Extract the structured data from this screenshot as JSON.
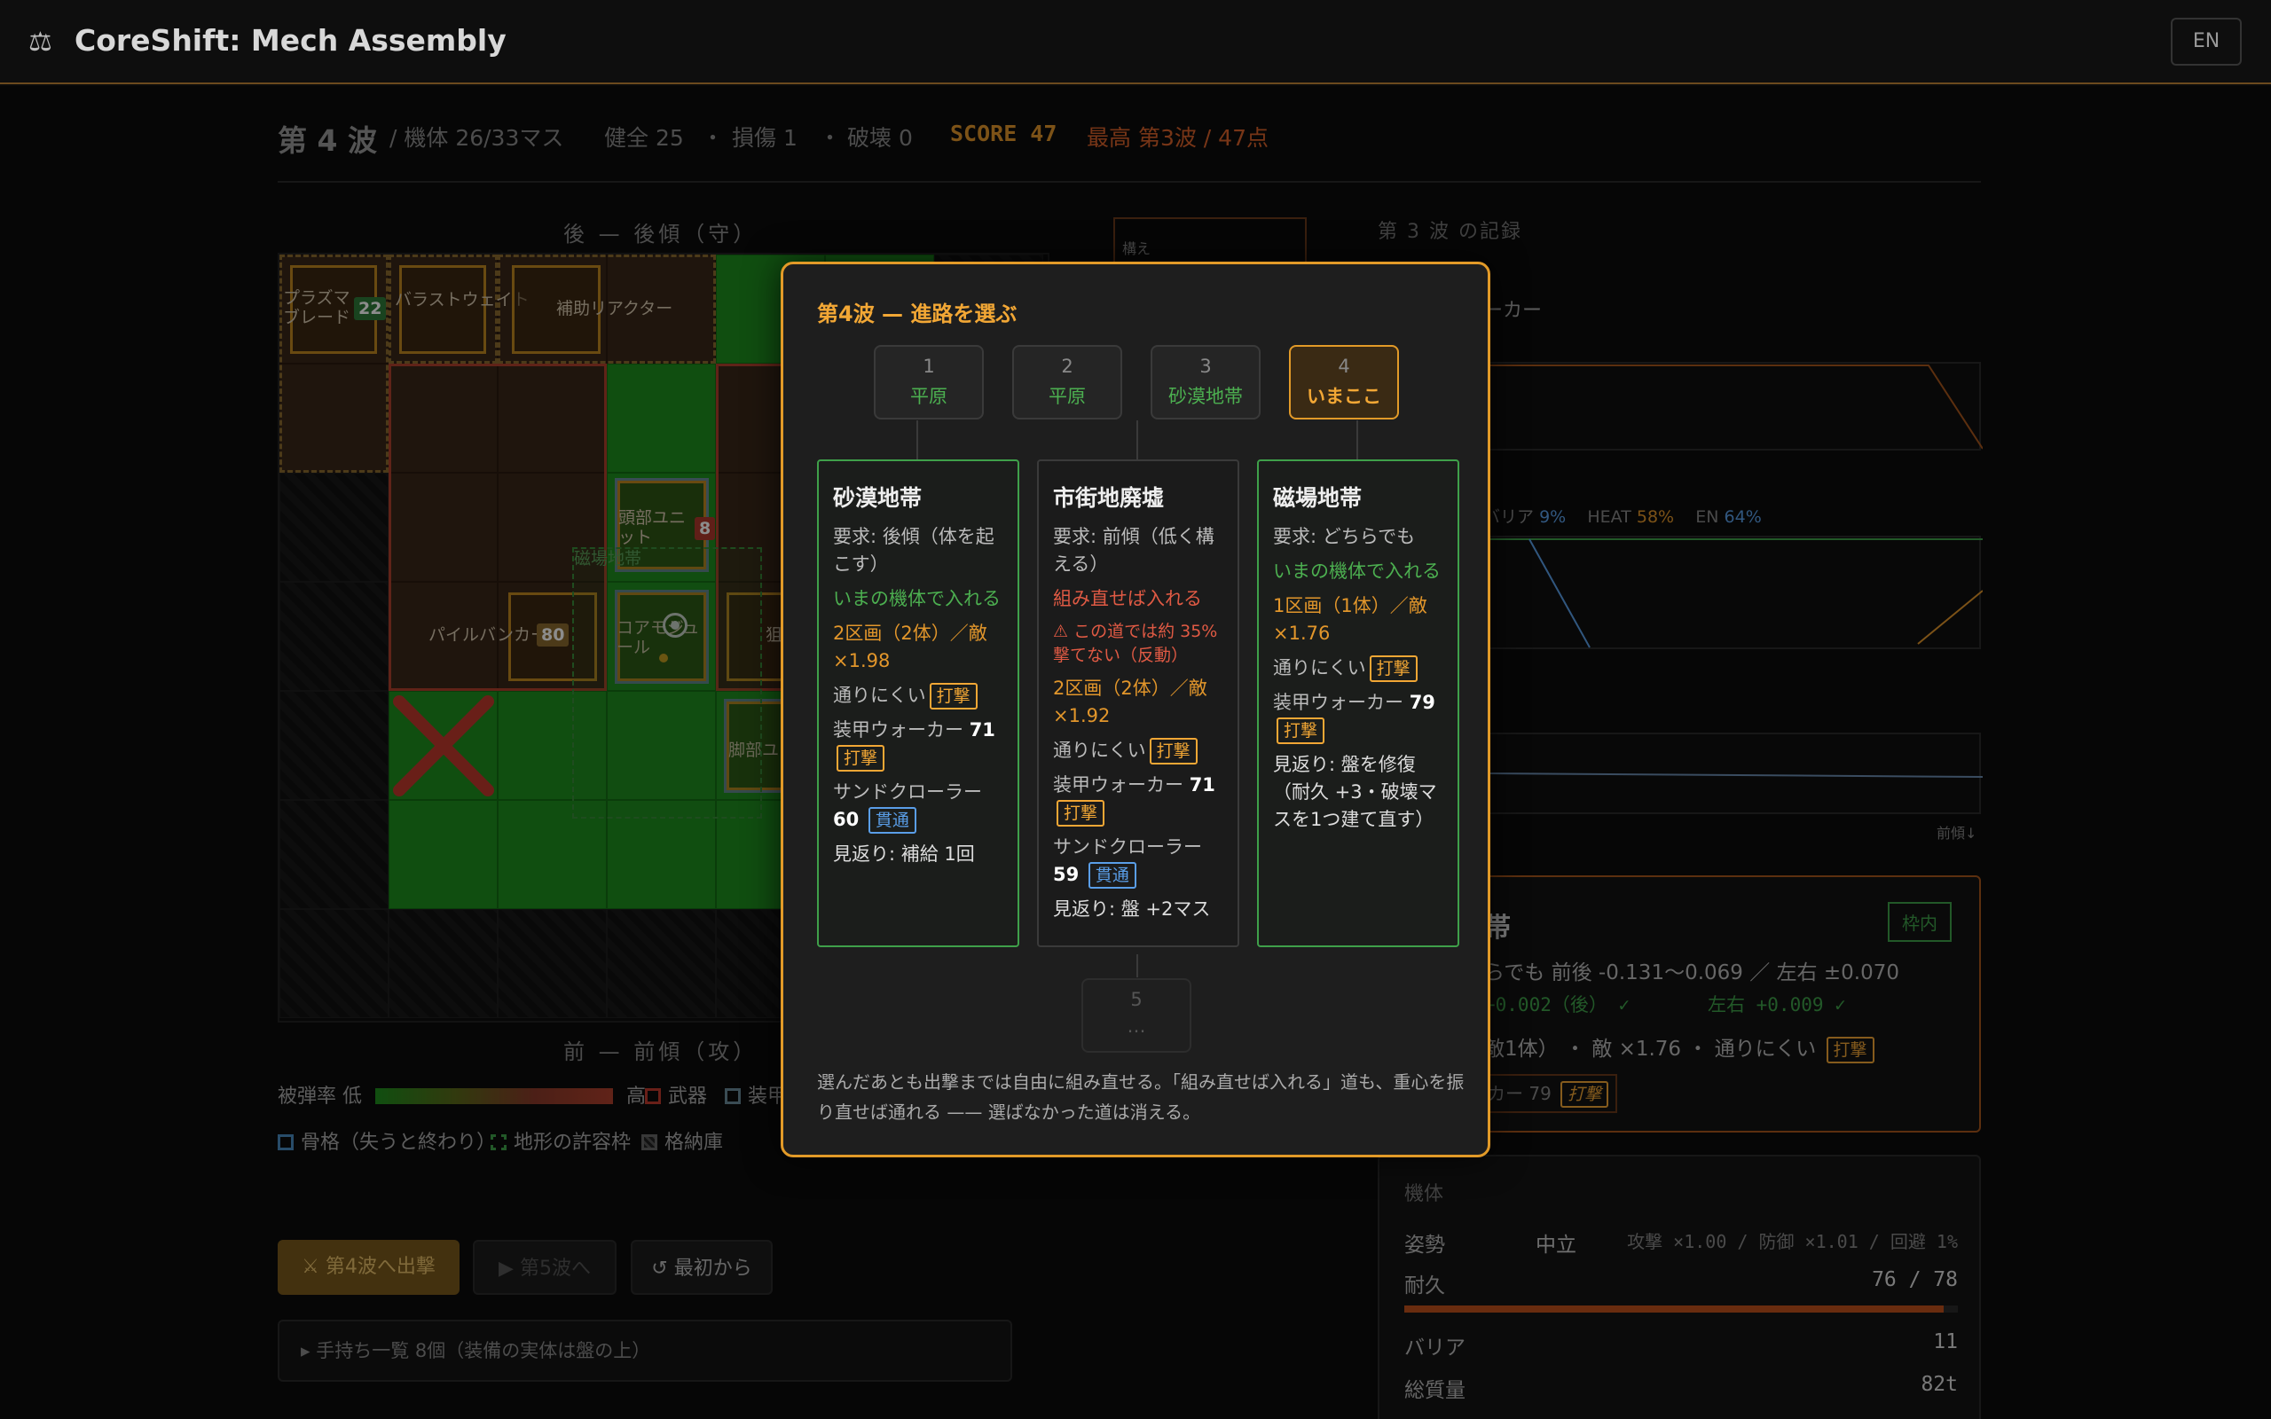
{
  "header": {
    "title": "CoreShift: Mech Assembly",
    "logo_icon": "balance-icon",
    "lang_button": "EN"
  },
  "status": {
    "wave": "第 4 波",
    "frame": "/ 機体 26/33マス",
    "healthy": "健全 25",
    "sep1": "・",
    "damaged": "損傷 1",
    "sep2": "・",
    "destroyed": "破壊 0",
    "score": "SCORE 47",
    "best": "最高 第3波 / 47点"
  },
  "grid": {
    "top_label": "後 — 後傾（守）",
    "bottom_label": "前 — 前傾（攻）",
    "parts": {
      "plasma_blade": "プラズマブレード",
      "plasma_blade_value": "22",
      "ballast": "バラストウェイト",
      "aux_reactor": "補助リアクター",
      "head_unit": "頭部ユニット",
      "head_unit_value": "8",
      "pile_bunker": "パイルバンカー",
      "pile_bunker_value": "80",
      "core_module": "コアモジュール",
      "leg_unit": "脚部ユ",
      "sniper": "狙",
      "terrain_overlay": "磁場地帯"
    }
  },
  "legend": {
    "hit_rate_low": "被弾率 低",
    "hit_rate_high": "高",
    "weapon": "武器",
    "armor": "装甲",
    "skeleton": "骨格（失うと終わり）",
    "terrain_tolerance": "地形の許容枠",
    "storage": "格納庫"
  },
  "actions": {
    "sortie": "⚔ 第4波へ出撃",
    "next_wave": "▶ 第5波へ",
    "restart": "↺ 最初から",
    "inventory": "▸ 手持ち一覧 8個（装備の実体は盤の上）"
  },
  "right_panel": {
    "record_label": "第 3 波 の記録",
    "walker_partial": "ーカー",
    "stance_label": "構え",
    "barrier_label": "バリア",
    "barrier_value": "9%",
    "heat_label": "HEAT",
    "heat_value": "58%",
    "en_label": "EN",
    "en_value": "64%",
    "forward_hint": "前傾↓",
    "terrain_card": {
      "title_partial": "帯",
      "in_frame": "枠内",
      "line1": "らでも 前後 -0.131〜0.069 ／ 左右 ±0.070",
      "line2a": "+0.002（後） ✓",
      "line2b": "左右 +0.009 ✓",
      "line3": "敵1体） ・ 敵 ×1.76 ・ 通りにくい",
      "line3_tag": "打撃",
      "line4": "カー 79",
      "line4_tag": "打撃"
    },
    "machine": {
      "title": "機体",
      "stance_label": "姿勢",
      "stance_value": "中立",
      "stance_detail": "攻撃 ×1.00 / 防御 ×1.01 / 回避 1%",
      "durability_label": "耐久",
      "durability_value": "76 / 78",
      "durability_fraction": 0.974,
      "barrier_label": "バリア",
      "barrier_value": "11",
      "mass_label": "総質量",
      "mass_value": "82t"
    }
  },
  "dialog": {
    "title": "第4波 — 進路を選ぶ",
    "nodes": [
      {
        "n": "1",
        "t": "平原"
      },
      {
        "n": "2",
        "t": "平原"
      },
      {
        "n": "3",
        "t": "砂漠地帯"
      },
      {
        "n": "4",
        "t": "いまここ"
      }
    ],
    "routes": [
      {
        "name": "砂漠地帯",
        "req": "要求: 後傾（体を起こす）",
        "fit": "いまの機体で入れる",
        "zones": "2区画（2体）／敵×1.98",
        "pass": "通りにくい",
        "pass_tag": "打撃",
        "enemy1": "装甲ウォーカー",
        "enemy1_v": "71",
        "enemy1_tag": "打撃",
        "enemy2": "サンドクローラー",
        "enemy2_v": "60",
        "enemy2_tag": "貫通",
        "reward": "見返り: 補給 1回"
      },
      {
        "name": "市街地廃墟",
        "req": "要求: 前傾（低く構える）",
        "fit": "組み直せば入れる",
        "warn": "⚠ この道では約 35% 撃てない（反動）",
        "zones": "2区画（2体）／敵×1.92",
        "pass": "通りにくい",
        "pass_tag": "打撃",
        "enemy1": "装甲ウォーカー",
        "enemy1_v": "71",
        "enemy1_tag": "打撃",
        "enemy2": "サンドクローラー",
        "enemy2_v": "59",
        "enemy2_tag": "貫通",
        "reward": "見返り: 盤 +2マス"
      },
      {
        "name": "磁場地帯",
        "req": "要求: どちらでも",
        "fit": "いまの機体で入れる",
        "zones": "1区画（1体）／敵×1.76",
        "pass": "通りにくい",
        "pass_tag": "打撃",
        "enemy1": "装甲ウォーカー",
        "enemy1_v": "79",
        "enemy1_tag": "打撃",
        "reward": "見返り: 盤を修復（耐久 +3・破壊マスを1つ建て直す）"
      }
    ],
    "next_node": {
      "n": "5",
      "t": "…"
    },
    "note": "選んだあとも出撃までは自由に組み直せる。「組み直せば入れる」道も、重心を振り直せば通れる —— 選ばなかった道は消える。"
  },
  "colors": {
    "accent": "#e29a28",
    "ok": "#3fa04a",
    "danger": "#e05a44",
    "pierce": "#5a9ee8"
  }
}
